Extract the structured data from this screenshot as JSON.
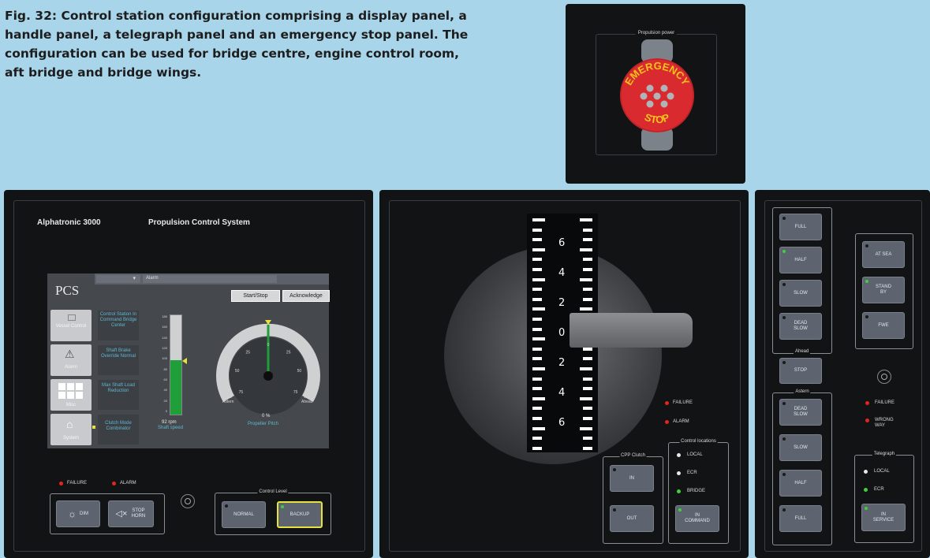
{
  "caption": "Fig. 32: Control station configuration comprising a display panel, a handle panel, a telegraph panel and an emergency stop panel. The configuration can be used for bridge centre, engine control room, aft bridge and bridge wings.",
  "estop_panel": {
    "frame_title": "Propulsion power",
    "button_top": "EMERGENCY",
    "button_bottom": "STOP"
  },
  "display_panel": {
    "brand": "Alphatronic 3000",
    "system_title": "Propulsion Control System",
    "screen": {
      "logo": "PCS",
      "dropdown_arrow": "▾",
      "alarm_field": "Alarm",
      "startstop_button": "Start/Stop",
      "acknowledge_button": "Acknowledge",
      "nav_buttons": [
        {
          "icon": "control-icon",
          "label": "Vessel Control"
        },
        {
          "icon": "warning-icon",
          "label": "Alarm"
        },
        {
          "icon": "grid-icon",
          "label": "Misc"
        },
        {
          "icon": "house-icon",
          "label": "System"
        }
      ],
      "status_items": [
        "Control Station In Command Bridge Center",
        "Shaft Brake Override Normal",
        "Max Shaft Load Reduction",
        "Clutch Mode Combinator"
      ],
      "bar_scale": [
        "180",
        "160",
        "140",
        "120",
        "100",
        "80",
        "60",
        "40",
        "20",
        "0"
      ],
      "bar_fill_fraction": 0.55,
      "bar_value": "92 rpm",
      "bar_label": "Shaft speed",
      "gauge_scale": [
        "75",
        "50",
        "25",
        "0",
        "25",
        "50",
        "75"
      ],
      "gauge_left_label": "Astern",
      "gauge_right_label": "Ahead",
      "gauge_left_max": "100",
      "gauge_right_max": "100",
      "gauge_value": "0 %",
      "gauge_label": "Propeller Pitch"
    },
    "indicators": [
      "FAILURE",
      "ALARM"
    ],
    "dim_button": "DIM",
    "horn_button": "STOP HORN",
    "control_level_title": "Control Level",
    "normal_button": "NORMAL",
    "backup_button": "BACKUP"
  },
  "handle_panel": {
    "scale_numbers": [
      "6",
      "4",
      "2",
      "0",
      "2",
      "4",
      "6"
    ],
    "indicators": [
      "FAILURE",
      "ALARM"
    ],
    "cpp_title": "CPP Clutch",
    "cpp_in": "IN",
    "cpp_out": "OUT",
    "locations_title": "Control locations",
    "locations": [
      "LOCAL",
      "ECR",
      "BRIDGE"
    ],
    "in_command_button": "IN COMMAND"
  },
  "telegraph_panel": {
    "ahead_buttons": [
      "FULL",
      "HALF",
      "SLOW",
      "DEAD SLOW"
    ],
    "ahead_title": "Ahead",
    "stop_button": "STOP",
    "astern_title": "Astern",
    "astern_buttons": [
      "DEAD SLOW",
      "SLOW",
      "HALF",
      "FULL"
    ],
    "mode_buttons": [
      "AT SEA",
      "STAND BY",
      "FWE"
    ],
    "indicators": [
      "FAILURE",
      "WRONG WAY"
    ],
    "telegraph_title": "Telegraph",
    "telegraph_locations": [
      "LOCAL",
      "ECR"
    ],
    "in_service_button": "IN SERVICE"
  },
  "colors": {
    "background": "#a9d5ea",
    "panel": "#121315",
    "estop_red": "#d92b2f",
    "estop_text": "#f4c21c",
    "led_red": "#e52420",
    "led_green": "#3fd13a",
    "led_white": "#e8e8e8",
    "highlight_yellow": "#e6e43a"
  }
}
